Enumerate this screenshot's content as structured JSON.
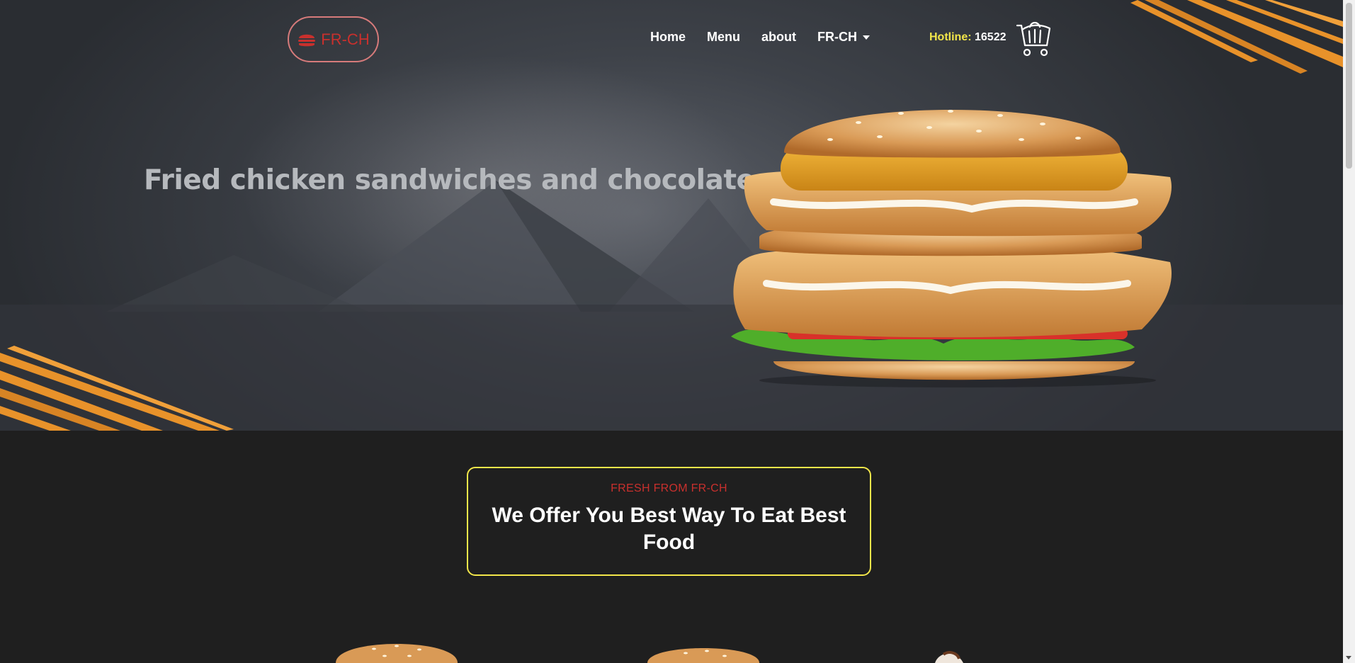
{
  "brand": {
    "logo_text": "FR-CH",
    "logo_icon": "burger-icon"
  },
  "nav": {
    "items": [
      {
        "label": "Home"
      },
      {
        "label": "Menu"
      },
      {
        "label": "about"
      },
      {
        "label": "FR-CH",
        "dropdown": true
      }
    ]
  },
  "hotline": {
    "label": "Hotline:",
    "number": "16522"
  },
  "cart": {
    "icon": "shopping-cart-icon"
  },
  "hero": {
    "title": "Fried chicken sandwiches and chocolate"
  },
  "offer": {
    "kicker": "FRESH FROM FR-CH",
    "heading": "We Offer You Best Way To Eat Best Food"
  },
  "colors": {
    "accent_red": "#c8302d",
    "accent_yellow": "#f2e64a",
    "brush_orange": "#e8922a",
    "page_dark": "#1f1f1f"
  }
}
